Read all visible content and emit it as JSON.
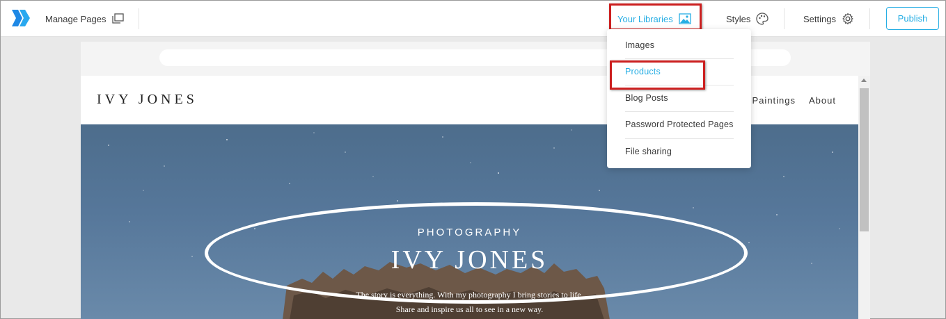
{
  "toolbar": {
    "manage_pages": "Manage Pages",
    "your_libraries": "Your Libraries",
    "styles": "Styles",
    "settings": "Settings",
    "publish": "Publish"
  },
  "library_menu": {
    "items": [
      "Images",
      "Products",
      "Blog Posts",
      "Password Protected Pages",
      "File sharing"
    ],
    "active": "Products"
  },
  "site": {
    "logo": "IVY JONES",
    "nav": [
      "Paintings",
      "About"
    ],
    "hero": {
      "kicker": "PHOTOGRAPHY",
      "title": "IVY JONES",
      "text_line1": "The story is everything. With my photography I bring stories to life.",
      "text_line2": "Share and inspire us all to see in a new way."
    }
  },
  "colors": {
    "accent": "#27aee4",
    "highlight_box": "#cc1f1f",
    "hero_sky": "#56779a"
  }
}
